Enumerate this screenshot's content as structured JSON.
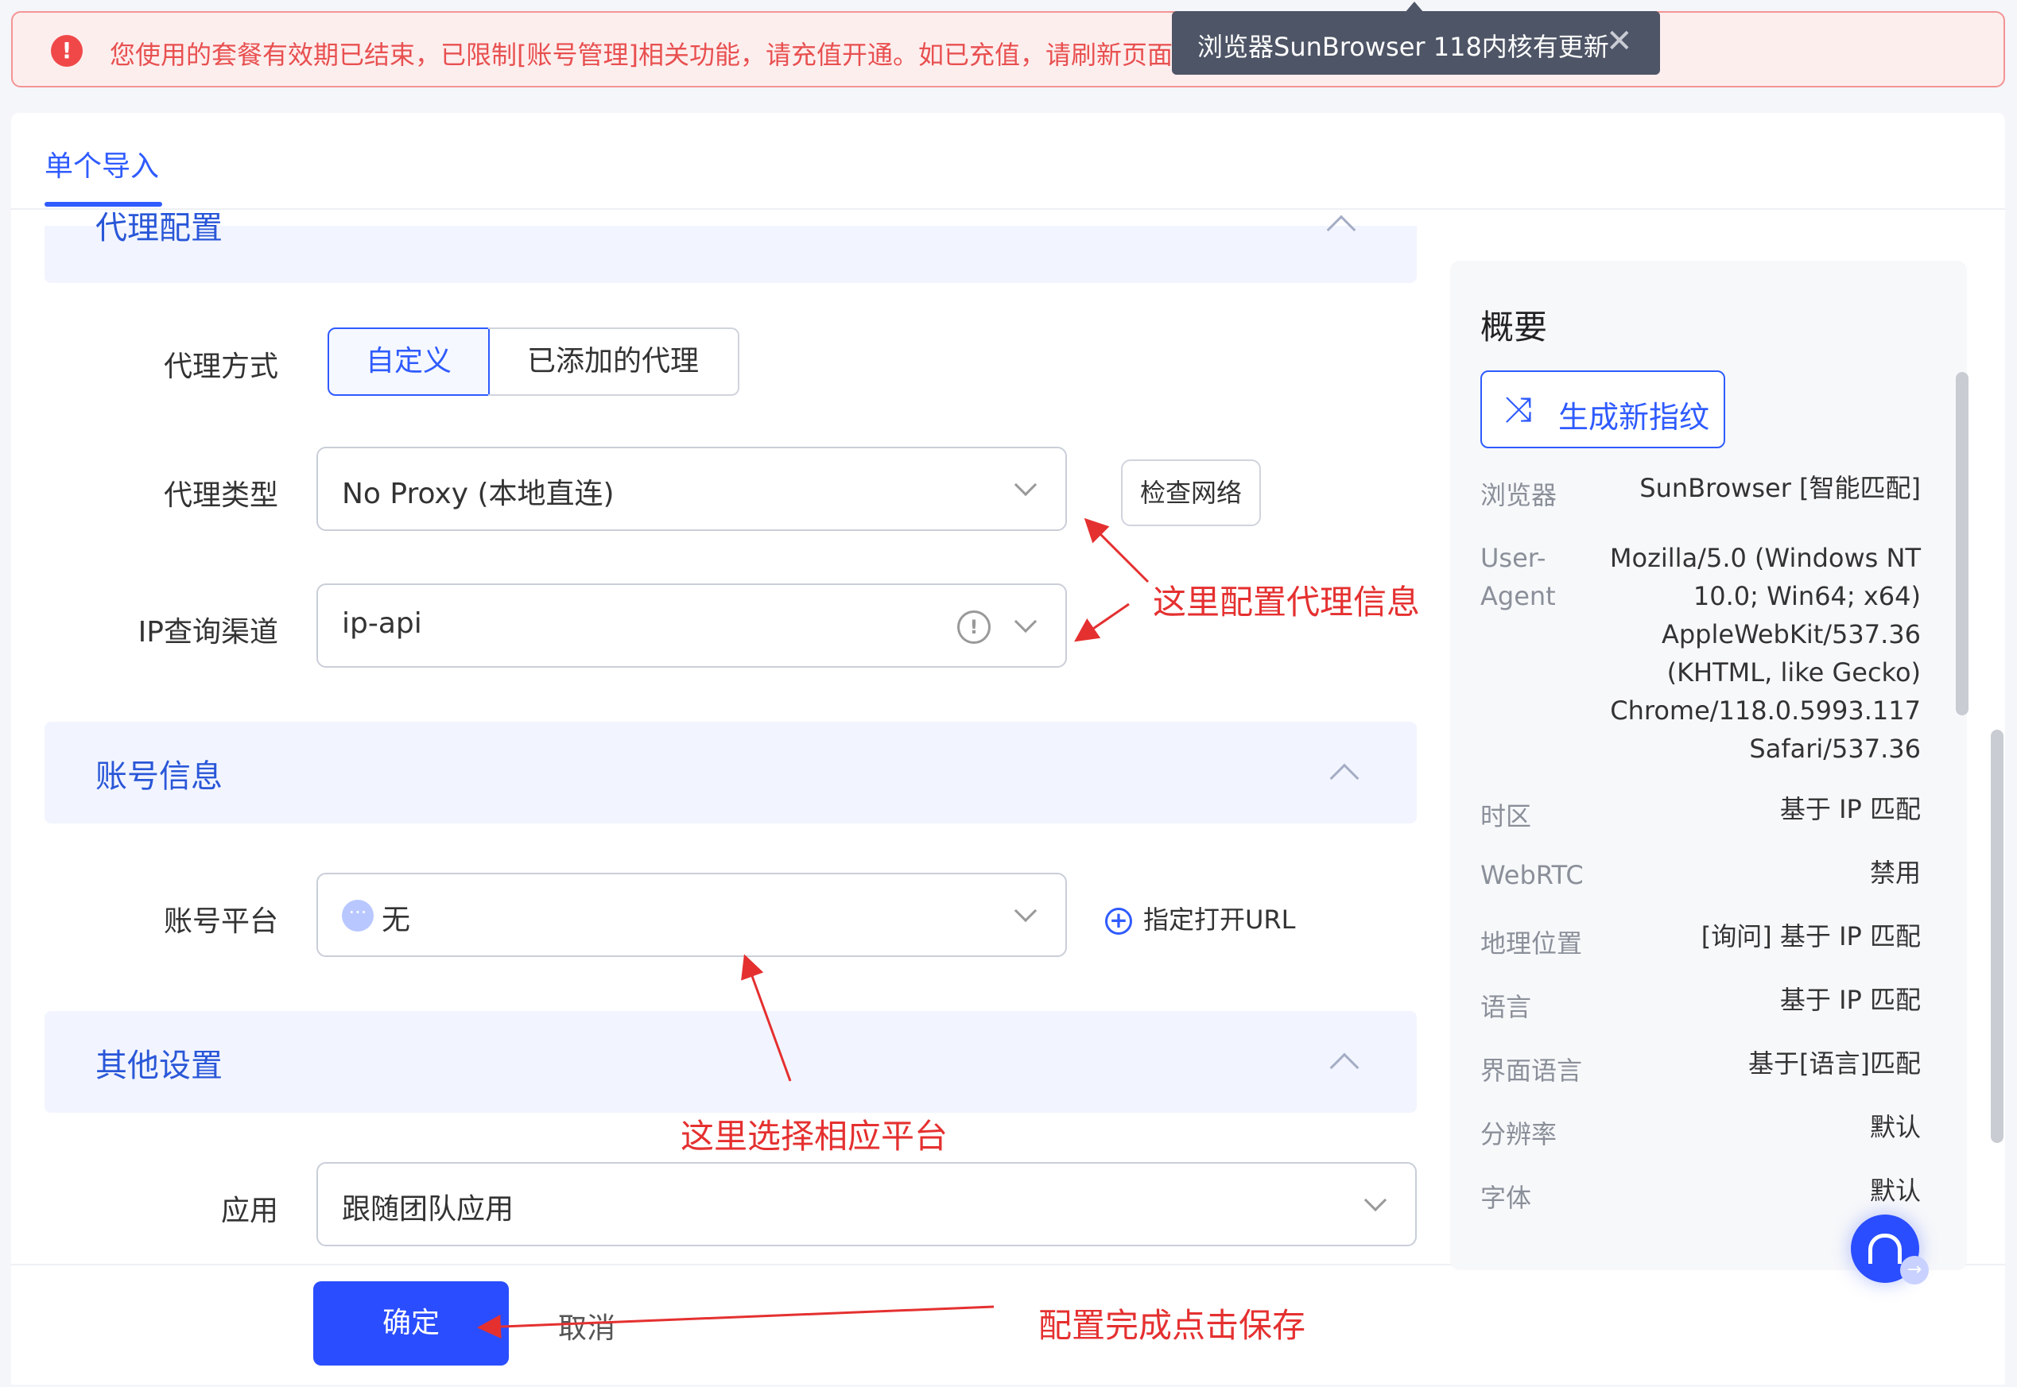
{
  "alert": {
    "message": "您使用的套餐有效期已结束，已限制[账号管理]相关功能，请充值开通。如已充值，请刷新页面。"
  },
  "toast": {
    "message": "浏览器SunBrowser 118内核有更新"
  },
  "tabs": {
    "active": "单个导入"
  },
  "sections": {
    "proxy": "代理配置",
    "account": "账号信息",
    "other": "其他设置"
  },
  "form": {
    "proxy_mode_label": "代理方式",
    "proxy_mode_options": [
      "自定义",
      "已添加的代理"
    ],
    "proxy_type_label": "代理类型",
    "proxy_type_value": "No Proxy (本地直连)",
    "check_network": "检查网络",
    "ip_channel_label": "IP查询渠道",
    "ip_channel_value": "ip-api",
    "platform_label": "账号平台",
    "platform_value": "无",
    "open_url": "指定打开URL",
    "app_label": "应用",
    "app_value": "跟随团队应用"
  },
  "footer": {
    "confirm": "确定",
    "cancel": "取消"
  },
  "overview": {
    "title": "概要",
    "generate": "生成新指纹",
    "rows": [
      {
        "key": "浏览器",
        "value": "SunBrowser [智能匹配]"
      },
      {
        "key": "User-Agent",
        "key_lines": [
          "User-",
          "Agent"
        ],
        "value_lines": [
          "Mozilla/5.0 (Windows NT",
          "10.0; Win64; x64)",
          "AppleWebKit/537.36",
          "(KHTML, like Gecko)",
          "Chrome/118.0.5993.117",
          "Safari/537.36"
        ]
      },
      {
        "key": "时区",
        "value": "基于 IP 匹配"
      },
      {
        "key": "WebRTC",
        "value": "禁用"
      },
      {
        "key": "地理位置",
        "value": "[询问] 基于 IP 匹配"
      },
      {
        "key": "语言",
        "value": "基于 IP 匹配"
      },
      {
        "key": "界面语言",
        "value": "基于[语言]匹配"
      },
      {
        "key": "分辨率",
        "value": "默认"
      },
      {
        "key": "字体",
        "value": "默认"
      }
    ]
  },
  "annotations": {
    "proxy": "这里配置代理信息",
    "platform": "这里选择相应平台",
    "save": "配置完成点击保存"
  },
  "colors": {
    "accent": "#2f5bff",
    "alert": "#e85050",
    "annotation": "#e53030"
  }
}
